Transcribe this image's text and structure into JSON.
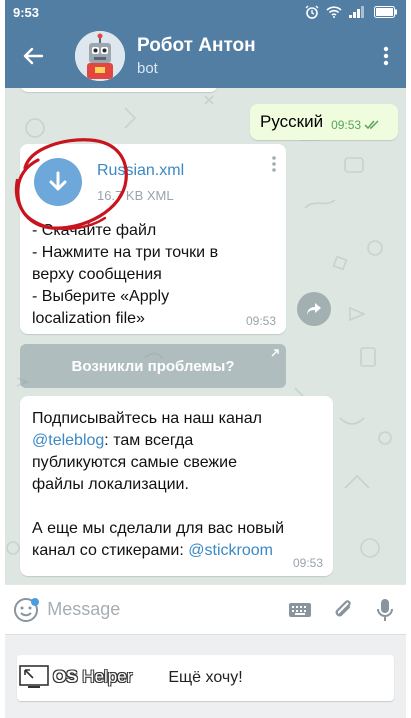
{
  "status_bar": {
    "time": "9:53"
  },
  "header": {
    "title": "Робот Антон",
    "subtitle": "bot"
  },
  "messages": {
    "outgoing": {
      "text": "Русский",
      "time": "09:53"
    },
    "file": {
      "name": "Russian.xml",
      "size": "16.7 KB XML",
      "lines": [
        "- Скачайте файл",
        "- Нажмите на три точки в",
        "верху сообщения",
        "- Выберите «Apply",
        "localization file»"
      ],
      "time": "09:53"
    },
    "inline_button": {
      "label": "Возникли проблемы?"
    },
    "news": {
      "line1": "Подписывайтесь на наш канал",
      "link1": "@teleblog",
      "line2": ": там всегда",
      "line3": "публикуются самые свежие",
      "line4": "файлы локализации.",
      "line5": "А еще мы сделали для вас новый",
      "line6": "канал со стикерами: ",
      "link2": "@stickroom",
      "time": "09:53"
    }
  },
  "input": {
    "placeholder": "Message"
  },
  "keyboard": {
    "button_label": "Ещё хочу!"
  },
  "watermark": {
    "text_os": "OS",
    "text_helper": "Helper"
  },
  "colors": {
    "header": "#527ea4",
    "link": "#3a89c6",
    "outgoing_bubble": "#effdde",
    "chat_background": "#dde6e0",
    "annotation": "#c8141e"
  }
}
